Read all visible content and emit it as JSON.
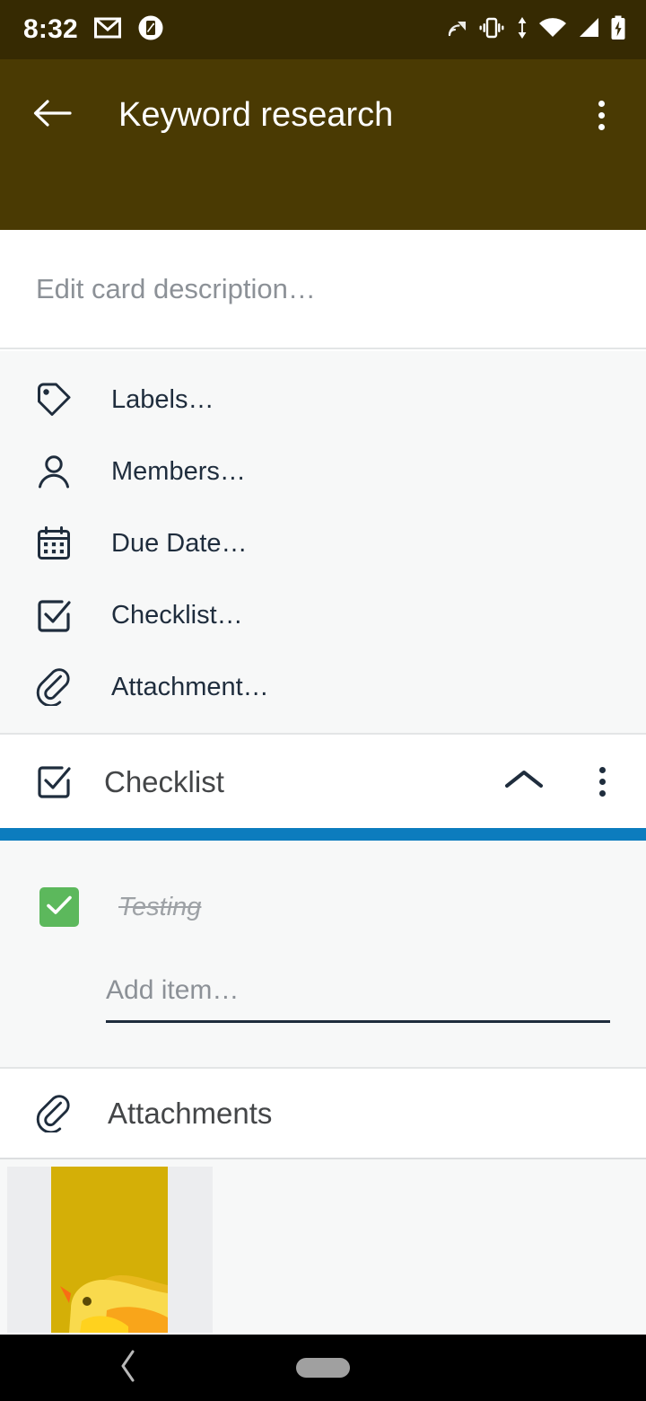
{
  "status_bar": {
    "clock": "8:32",
    "background": "#362A02",
    "left_icons": [
      "gmail-icon",
      "screenshot-icon"
    ],
    "right_icons": [
      "cast-icon",
      "vibrate-icon",
      "data-transfer-icon",
      "wifi-icon",
      "cellular-signal-icon",
      "battery-charging-icon"
    ]
  },
  "app_bar": {
    "title": "Keyword research",
    "background": "#4A3A03",
    "back_icon": "arrow-back-icon",
    "overflow_icon": "more-vertical-icon"
  },
  "description": {
    "placeholder": "Edit card description…",
    "value": ""
  },
  "action_menu": {
    "items": [
      {
        "label": "Labels…",
        "icon": "label-tag-icon"
      },
      {
        "label": "Members…",
        "icon": "person-icon"
      },
      {
        "label": "Due Date…",
        "icon": "calendar-icon"
      },
      {
        "label": "Checklist…",
        "icon": "checkbox-checked-icon"
      },
      {
        "label": "Attachment…",
        "icon": "paperclip-icon"
      }
    ]
  },
  "checklist": {
    "title": "Checklist",
    "icon": "checkbox-checked-icon",
    "collapse_icon": "chevron-up-icon",
    "overflow_icon": "more-vertical-icon",
    "progress_percent": 100,
    "progress_color": "#0C7CBE",
    "checkbox_color": "#5CB85C",
    "items": [
      {
        "label": "Testing",
        "checked": true
      }
    ],
    "add_item_placeholder": "Add item…"
  },
  "attachments": {
    "title": "Attachments",
    "icon": "paperclip-icon",
    "items": [
      {
        "name": "duck-thumbnail",
        "background": "#D4AF07"
      }
    ]
  },
  "nav_bar": {
    "background": "#000000",
    "back_icon": "chevron-back-icon",
    "home_icon": "home-pill-icon"
  }
}
